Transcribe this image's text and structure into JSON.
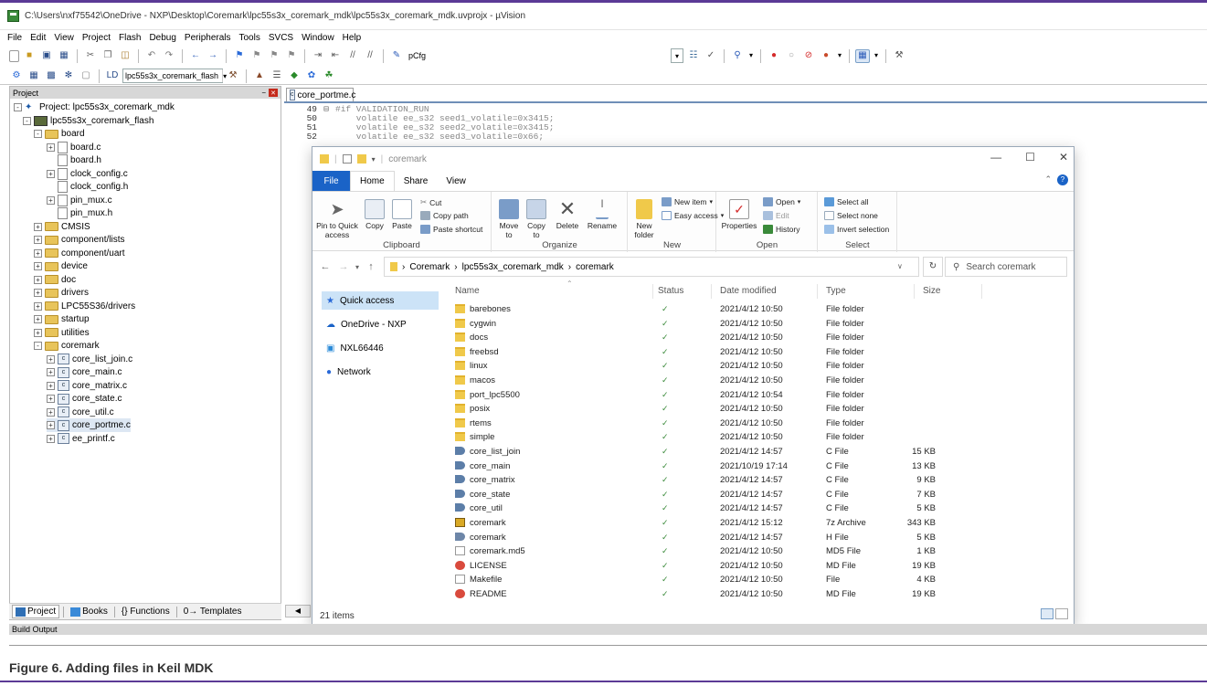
{
  "window_title": "C:\\Users\\nxf75542\\OneDrive - NXP\\Desktop\\Coremark\\lpc55s3x_coremark_mdk\\lpc55s3x_coremark_mdk.uvprojx - µVision",
  "menu": [
    "File",
    "Edit",
    "View",
    "Project",
    "Flash",
    "Debug",
    "Peripherals",
    "Tools",
    "SVCS",
    "Window",
    "Help"
  ],
  "toolbar": {
    "find_field": "pCfg",
    "target_select": "lpc55s3x_coremark_flash"
  },
  "project_pane": {
    "title": "Project",
    "tree": [
      {
        "label": "Project: lpc55s3x_coremark_mdk",
        "icon": "project-icon",
        "level": 0,
        "expander": "-"
      },
      {
        "label": "lpc55s3x_coremark_flash",
        "icon": "target-icon",
        "level": 1,
        "expander": "-"
      },
      {
        "label": "board",
        "icon": "folder-icon",
        "level": 2,
        "expander": "-"
      },
      {
        "label": "board.c",
        "icon": "file-icon",
        "level": 3,
        "expander": "+"
      },
      {
        "label": "board.h",
        "icon": "file-icon",
        "level": 3,
        "expander": ""
      },
      {
        "label": "clock_config.c",
        "icon": "file-icon",
        "level": 3,
        "expander": "+"
      },
      {
        "label": "clock_config.h",
        "icon": "file-icon",
        "level": 3,
        "expander": ""
      },
      {
        "label": "pin_mux.c",
        "icon": "file-icon",
        "level": 3,
        "expander": "+"
      },
      {
        "label": "pin_mux.h",
        "icon": "file-icon",
        "level": 3,
        "expander": ""
      },
      {
        "label": "CMSIS",
        "icon": "folder-icon",
        "level": 2,
        "expander": "+"
      },
      {
        "label": "component/lists",
        "icon": "folder-icon",
        "level": 2,
        "expander": "+"
      },
      {
        "label": "component/uart",
        "icon": "folder-icon",
        "level": 2,
        "expander": "+"
      },
      {
        "label": "device",
        "icon": "folder-icon",
        "level": 2,
        "expander": "+"
      },
      {
        "label": "doc",
        "icon": "folder-icon",
        "level": 2,
        "expander": "+"
      },
      {
        "label": "drivers",
        "icon": "folder-icon",
        "level": 2,
        "expander": "+"
      },
      {
        "label": "LPC55S36/drivers",
        "icon": "folder-icon",
        "level": 2,
        "expander": "+"
      },
      {
        "label": "startup",
        "icon": "folder-icon",
        "level": 2,
        "expander": "+"
      },
      {
        "label": "utilities",
        "icon": "folder-icon",
        "level": 2,
        "expander": "+"
      },
      {
        "label": "coremark",
        "icon": "folder-icon",
        "level": 2,
        "expander": "-"
      },
      {
        "label": "core_list_join.c",
        "icon": "c-file-icon",
        "level": 3,
        "expander": "+"
      },
      {
        "label": "core_main.c",
        "icon": "c-file-icon",
        "level": 3,
        "expander": "+"
      },
      {
        "label": "core_matrix.c",
        "icon": "c-file-icon",
        "level": 3,
        "expander": "+"
      },
      {
        "label": "core_state.c",
        "icon": "c-file-icon",
        "level": 3,
        "expander": "+"
      },
      {
        "label": "core_util.c",
        "icon": "c-file-icon",
        "level": 3,
        "expander": "+"
      },
      {
        "label": "core_portme.c",
        "icon": "c-file-icon",
        "level": 3,
        "expander": "+"
      },
      {
        "label": "ee_printf.c",
        "icon": "c-file-icon",
        "level": 3,
        "expander": "+"
      }
    ],
    "tabs": [
      "Project",
      "Books",
      "{} Functions",
      "0→ Templates"
    ]
  },
  "editor": {
    "tab": "core_portme.c",
    "lines": [
      {
        "n": "49",
        "text": "#if VALIDATION_RUN"
      },
      {
        "n": "50",
        "text": "    volatile ee_s32 seed1_volatile=0x3415;"
      },
      {
        "n": "51",
        "text": "    volatile ee_s32 seed2_volatile=0x3415;"
      },
      {
        "n": "52",
        "text": "    volatile ee_s32 seed3_volatile=0x66;"
      }
    ]
  },
  "explorer": {
    "title": "coremark",
    "ribbon_tabs": [
      "File",
      "Home",
      "Share",
      "View"
    ],
    "clipboard": {
      "label": "Clipboard",
      "pin": "Pin to Quick access",
      "copy": "Copy",
      "paste": "Paste",
      "cut": "Cut",
      "copy_path": "Copy path",
      "paste_shortcut": "Paste shortcut"
    },
    "organize": {
      "label": "Organize",
      "move_to": "Move to",
      "copy_to": "Copy to",
      "delete": "Delete",
      "rename": "Rename"
    },
    "new": {
      "label": "New",
      "new_folder": "New folder",
      "new_item": "New item",
      "easy_access": "Easy access"
    },
    "open": {
      "label": "Open",
      "properties": "Properties",
      "open": "Open",
      "edit": "Edit",
      "history": "History"
    },
    "select": {
      "label": "Select",
      "select_all": "Select all",
      "select_none": "Select none",
      "invert": "Invert selection"
    },
    "breadcrumb": [
      "Coremark",
      "lpc55s3x_coremark_mdk",
      "coremark"
    ],
    "search_placeholder": "Search coremark",
    "nav": [
      "Quick access",
      "OneDrive - NXP",
      "NXL66446",
      "Network"
    ],
    "columns": [
      "Name",
      "Status",
      "Date modified",
      "Type",
      "Size"
    ],
    "files": [
      {
        "name": "barebones",
        "date": "2021/4/12 10:50",
        "type": "File folder",
        "size": "",
        "icon": "folder-icon"
      },
      {
        "name": "cygwin",
        "date": "2021/4/12 10:50",
        "type": "File folder",
        "size": "",
        "icon": "folder-icon"
      },
      {
        "name": "docs",
        "date": "2021/4/12 10:50",
        "type": "File folder",
        "size": "",
        "icon": "folder-icon"
      },
      {
        "name": "freebsd",
        "date": "2021/4/12 10:50",
        "type": "File folder",
        "size": "",
        "icon": "folder-icon"
      },
      {
        "name": "linux",
        "date": "2021/4/12 10:50",
        "type": "File folder",
        "size": "",
        "icon": "folder-icon"
      },
      {
        "name": "macos",
        "date": "2021/4/12 10:50",
        "type": "File folder",
        "size": "",
        "icon": "folder-icon"
      },
      {
        "name": "port_lpc5500",
        "date": "2021/4/12 10:54",
        "type": "File folder",
        "size": "",
        "icon": "folder-icon"
      },
      {
        "name": "posix",
        "date": "2021/4/12 10:50",
        "type": "File folder",
        "size": "",
        "icon": "folder-icon"
      },
      {
        "name": "rtems",
        "date": "2021/4/12 10:50",
        "type": "File folder",
        "size": "",
        "icon": "folder-icon"
      },
      {
        "name": "simple",
        "date": "2021/4/12 10:50",
        "type": "File folder",
        "size": "",
        "icon": "folder-icon"
      },
      {
        "name": "core_list_join",
        "date": "2021/4/12 14:57",
        "type": "C File",
        "size": "15 KB",
        "icon": "c-file-icon"
      },
      {
        "name": "core_main",
        "date": "2021/10/19 17:14",
        "type": "C File",
        "size": "13 KB",
        "icon": "c-file-icon"
      },
      {
        "name": "core_matrix",
        "date": "2021/4/12 14:57",
        "type": "C File",
        "size": "9 KB",
        "icon": "c-file-icon"
      },
      {
        "name": "core_state",
        "date": "2021/4/12 14:57",
        "type": "C File",
        "size": "7 KB",
        "icon": "c-file-icon"
      },
      {
        "name": "core_util",
        "date": "2021/4/12 14:57",
        "type": "C File",
        "size": "5 KB",
        "icon": "c-file-icon"
      },
      {
        "name": "coremark",
        "date": "2021/4/12 15:12",
        "type": "7z Archive",
        "size": "343 KB",
        "icon": "archive-icon"
      },
      {
        "name": "coremark",
        "date": "2021/4/12 14:57",
        "type": "H File",
        "size": "5 KB",
        "icon": "h-file-icon"
      },
      {
        "name": "coremark.md5",
        "date": "2021/4/12 10:50",
        "type": "MD5 File",
        "size": "1 KB",
        "icon": "text-file-icon"
      },
      {
        "name": "LICENSE",
        "date": "2021/4/12 10:50",
        "type": "MD File",
        "size": "19 KB",
        "icon": "md-file-icon"
      },
      {
        "name": "Makefile",
        "date": "2021/4/12 10:50",
        "type": "File",
        "size": "4 KB",
        "icon": "text-file-icon"
      },
      {
        "name": "README",
        "date": "2021/4/12 10:50",
        "type": "MD File",
        "size": "19 KB",
        "icon": "md-file-icon"
      }
    ],
    "status": "21 items"
  },
  "build_output": "Build Output",
  "caption": "Figure 6.  Adding files in Keil MDK",
  "colors": {
    "explorer_accent": "#1a63c7",
    "selection": "#cce3f7",
    "caption_rule": "#5b3a96"
  }
}
